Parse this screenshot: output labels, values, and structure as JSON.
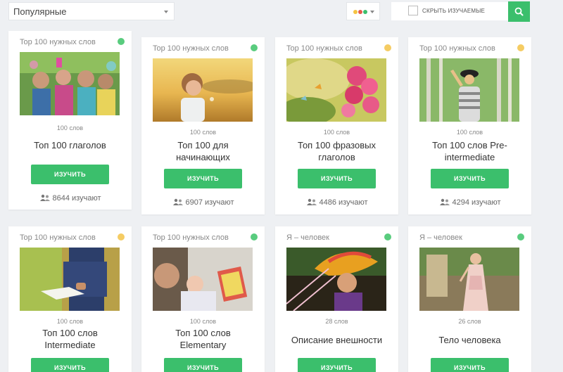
{
  "toolbar": {
    "sort_value": "Популярные",
    "hide_learned_label": "СКРЫТЬ ИЗУЧАЕМЫЕ",
    "level_colors": [
      "#f5c342",
      "#e55b4b",
      "#3bbf6c"
    ]
  },
  "colors": {
    "accent": "#3bbf6c",
    "dot_green": "#59cc7e",
    "dot_yellow": "#f5cc63"
  },
  "cards": [
    {
      "category": "Top 100 нужных слов",
      "dot": "green",
      "words": "100 слов",
      "title_lines": [
        "Топ 100 глаголов",
        ""
      ],
      "button": "ИЗУЧИТЬ",
      "learners": "8644 изучают",
      "image": "friends-selfie"
    },
    {
      "category": "Top 100 нужных слов",
      "dot": "green",
      "words": "100 слов",
      "title_lines": [
        "Топ 100 для",
        "начинающих"
      ],
      "button": "ИЗУЧИТЬ",
      "learners": "6907 изучают",
      "image": "child-field"
    },
    {
      "category": "Top 100 нужных слов",
      "dot": "yellow",
      "words": "100 слов",
      "title_lines": [
        "Топ 100 фразовых",
        "глаголов"
      ],
      "button": "ИЗУЧИТЬ",
      "learners": "4486 изучают",
      "image": "flowers-butterflies"
    },
    {
      "category": "Top 100 нужных слов",
      "dot": "yellow",
      "words": "100 слов",
      "title_lines": [
        "Топ 100 слов Pre-",
        "intermediate"
      ],
      "button": "ИЗУЧИТЬ",
      "learners": "4294 изучают",
      "image": "woman-hat-forest"
    },
    {
      "category": "Top 100 нужных слов",
      "dot": "yellow",
      "words": "100 слов",
      "title_lines": [
        "Топ 100 слов",
        "Intermediate"
      ],
      "button": "ИЗУЧИТЬ",
      "learners": "",
      "image": "man-reading-book"
    },
    {
      "category": "Top 100 нужных слов",
      "dot": "green",
      "words": "100 слов",
      "title_lines": [
        "Топ 100 слов",
        "Elementary"
      ],
      "button": "ИЗУЧИТЬ",
      "learners": "",
      "image": "father-child-book"
    },
    {
      "category": "Я – человек",
      "dot": "green",
      "words": "28 слов",
      "title_lines": [
        "Описание внешности",
        ""
      ],
      "button": "ИЗУЧИТЬ",
      "learners": "",
      "image": "woman-headdress"
    },
    {
      "category": "Я – человек",
      "dot": "green",
      "words": "26 слов",
      "title_lines": [
        "Тело человека",
        ""
      ],
      "button": "ИЗУЧИТЬ",
      "learners": "",
      "image": "woman-dress"
    }
  ]
}
